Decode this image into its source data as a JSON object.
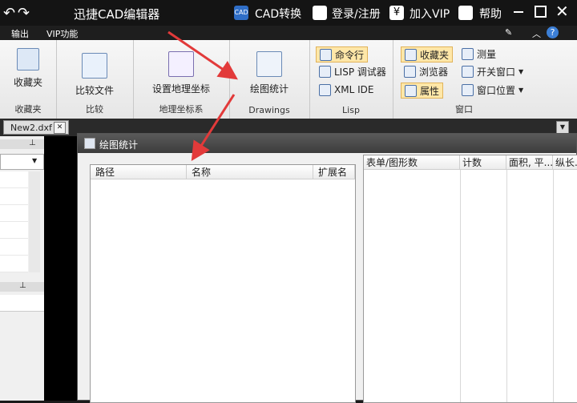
{
  "app": {
    "title": "迅捷CAD编辑器",
    "cad_convert": "CAD转换",
    "login": "登录/注册",
    "vip": "加入VIP",
    "help": "帮助"
  },
  "menubar": {
    "items": [
      "输出",
      "VIP功能"
    ]
  },
  "ribbon": {
    "groups": [
      {
        "label": "收藏夹",
        "button": "收藏夹"
      },
      {
        "label": "比较",
        "button": "比较文件"
      },
      {
        "label": "地理坐标系",
        "button": "设置地理坐标"
      },
      {
        "label": "Drawings",
        "button": "绘图统计"
      },
      {
        "label": "Lisp",
        "items": [
          "命令行",
          "LISP 调试器",
          "XML IDE"
        ]
      },
      {
        "label": "窗口",
        "items": [
          "收藏夹",
          "浏览器",
          "属性",
          "测量",
          "开关窗口",
          "窗口位置"
        ]
      }
    ]
  },
  "tabs": {
    "doc": "New2.dxf"
  },
  "dialog": {
    "title": "绘图统计",
    "left_columns": [
      "路径",
      "名称",
      "扩展名"
    ],
    "right_columns": [
      "表单/图形数",
      "计数",
      "面积, 平...",
      "纵长..."
    ]
  },
  "colors": {
    "accent": "#e23a3a",
    "titlebar": "#141414"
  }
}
